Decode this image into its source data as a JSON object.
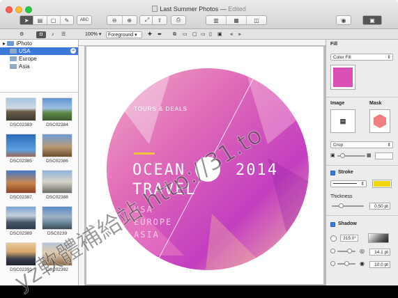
{
  "window": {
    "title": "Last Summer Photos",
    "edited": "Edited"
  },
  "toolbar": {
    "text_tool_label": "ABC",
    "zoom": "100%",
    "layer": "Foreground"
  },
  "sidebar": {
    "items": [
      {
        "label": "iPhoto",
        "selected": false
      },
      {
        "label": "USA",
        "selected": true
      },
      {
        "label": "Europe",
        "selected": false
      },
      {
        "label": "Asia",
        "selected": false
      }
    ]
  },
  "thumbnails": [
    "DSC02383",
    "DSC02384",
    "DSC02385",
    "DSC02386",
    "DSC02387",
    "DSC02388",
    "DSC02389",
    "DSC0239",
    "DSC02391",
    "DSC02392"
  ],
  "disc": {
    "tagline": "TOURS & DEALS",
    "line1": "OCEAN",
    "line2": "TRAVEL",
    "year": "2014",
    "dest1": "USA",
    "dest2": "EUROPE",
    "dest3": "ASIA"
  },
  "inspector": {
    "fill_label": "Fill",
    "fill_type": "Color Fill",
    "fill_color": "#d94fb4",
    "image_label": "Image",
    "mask_label": "Mask",
    "crop_label": "Crop",
    "stroke_label": "Stroke",
    "stroke_color": "#f2d40f",
    "thickness_label": "Thickness",
    "thickness_value": "0.50 pt",
    "shadow_label": "Shadow",
    "shadow_angle": "315.0°",
    "shadow_offset": "14.1 pt",
    "shadow_blur": "10.0 pt"
  },
  "watermark": {
    "text": "yz軟體補給站 http://31.to"
  }
}
